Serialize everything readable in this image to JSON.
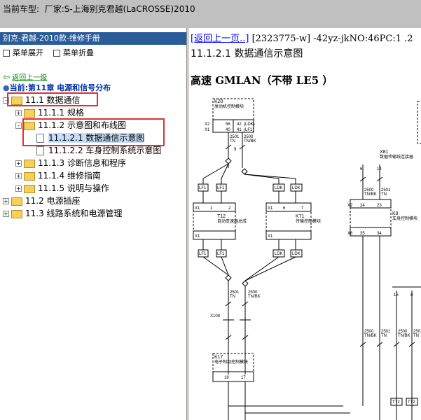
{
  "window": {
    "title_label": "当前车型:",
    "title_text": "厂家:S-上海别克君越(LaCROSSE)2010"
  },
  "left_panel": {
    "header": "别克-君越-2010款-维修手册",
    "expand_label": "菜单展开",
    "collapse_label": "菜单折叠",
    "back_label": "返回上一级",
    "current_label": "当前:第11章 电源和信号分布",
    "tree": [
      {
        "label": "11.1 数据通信",
        "toggle": "-",
        "kind": "folder"
      },
      {
        "label": "11.1.1 规格",
        "toggle": "+",
        "kind": "folder"
      },
      {
        "label": "11.1.2 示意图和布线图",
        "toggle": "-",
        "kind": "folder"
      },
      {
        "label": "11.1.2.1 数据通信示意图",
        "toggle": "",
        "kind": "doc"
      },
      {
        "label": "11.1.2.2 车身控制系统示意图",
        "toggle": "",
        "kind": "doc"
      },
      {
        "label": "11.1.3 诊断信息和程序",
        "toggle": "+",
        "kind": "folder"
      },
      {
        "label": "11.1.4 维修指南",
        "toggle": "+",
        "kind": "folder"
      },
      {
        "label": "11.1.5 说明与操作",
        "toggle": "+",
        "kind": "folder"
      },
      {
        "label": "11.2 电源插座",
        "toggle": "+",
        "kind": "folder"
      },
      {
        "label": "11.3 线路系统和电源管理",
        "toggle": "+",
        "kind": "folder"
      }
    ]
  },
  "right_panel": {
    "back_link": "[返回上一页..]",
    "doc_code": "[2323775-w] -42yz-jkNO:46PC:1 .2",
    "title": "11.1.2.1 数据通信示意图",
    "subtitle": "高速 GMLAN（不带 LE5 ）"
  },
  "diagram": {
    "k20_label": "K20",
    "k20_desc": "发动机控制模块",
    "k20_pins": [
      "X2",
      "X1",
      "56",
      "40",
      "42",
      "41"
    ],
    "k20_sigs": [
      "(LDK)",
      "(LF1)"
    ],
    "wire_codes": [
      "2501",
      "TN",
      "2500",
      "TN/BK"
    ],
    "ckt": "9",
    "lf1": "LF1",
    "ldk": "LDK",
    "t12_label": "T12",
    "t12_desc": "自动变速器总成",
    "k71_label": "K71",
    "k71_desc": "传输控制模块",
    "x_pins": [
      "X1",
      "1",
      "2",
      "6",
      "7"
    ],
    "x108": "X108",
    "k17_label": "K17",
    "k17_desc": "电子制动控制模块",
    "k17_pins": [
      "18",
      "17"
    ],
    "x81_label": "X81",
    "x81_desc": "数据传输线连接器",
    "k9_label": "K9",
    "k9_desc": "车身控制模块",
    "k9_pins": [
      "X2",
      "X6",
      "24",
      "23",
      "35",
      "34"
    ],
    "x81_pins": [
      "6",
      "14",
      "16",
      "8"
    ],
    "tt2": "TT2"
  }
}
